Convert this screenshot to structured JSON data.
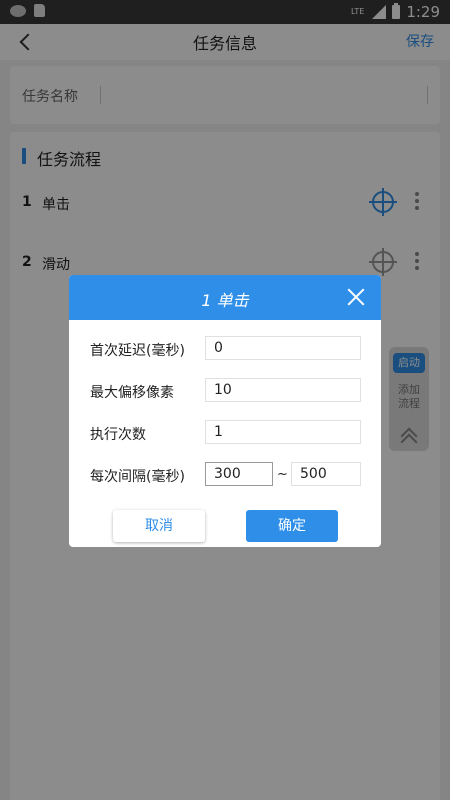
{
  "status_bar": {
    "network": "LTE",
    "time": "1:29"
  },
  "app_bar": {
    "title": "任务信息",
    "save_label": "保存"
  },
  "task_name": {
    "label": "任务名称"
  },
  "flow": {
    "title": "任务流程",
    "items": [
      {
        "index": "1",
        "name": "单击"
      },
      {
        "index": "2",
        "name": "滑动"
      }
    ]
  },
  "float_panel": {
    "start_label": "启动",
    "add_label": "添加流程"
  },
  "dialog": {
    "title": "1 单击",
    "fields": {
      "first_delay": {
        "label": "首次延迟(毫秒)",
        "value": "0"
      },
      "max_offset": {
        "label": "最大偏移像素",
        "value": "10"
      },
      "exec_count": {
        "label": "执行次数",
        "value": "1"
      },
      "interval": {
        "label": "每次间隔(毫秒)",
        "min": "300",
        "separator": "~",
        "max": "500"
      }
    },
    "cancel_label": "取消",
    "ok_label": "确定"
  },
  "colors": {
    "accent": "#2f8fe8"
  }
}
